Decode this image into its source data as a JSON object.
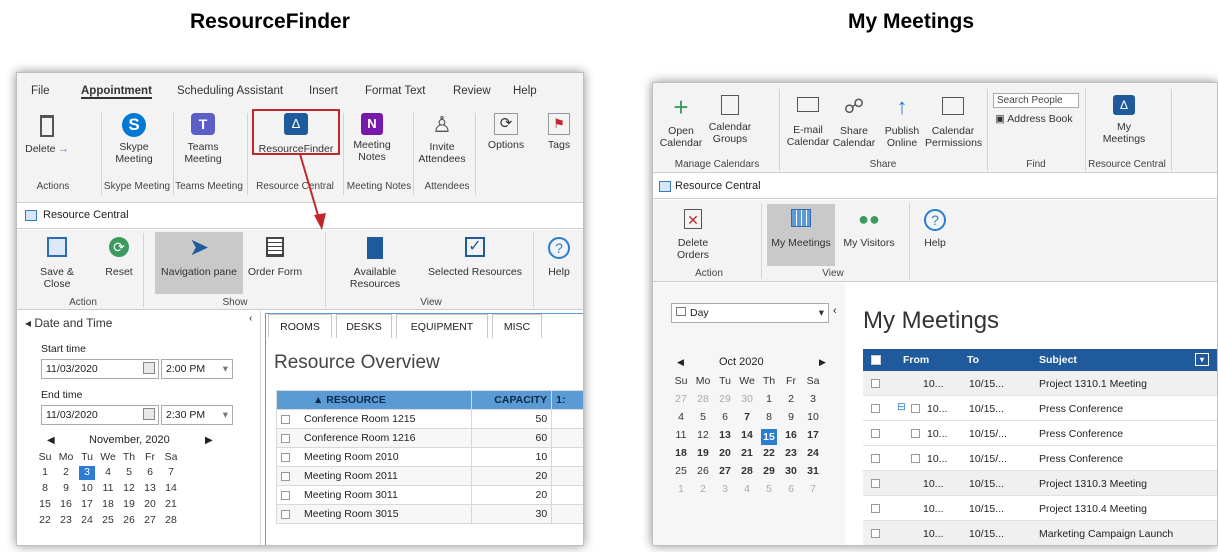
{
  "titles": {
    "left": "ResourceFinder",
    "right": "My Meetings"
  },
  "left": {
    "menu": [
      "File",
      "Appointment",
      "Scheduling Assistant",
      "Insert",
      "Format Text",
      "Review",
      "Help"
    ],
    "ribbon": {
      "delete": "Delete",
      "skype": "Skype Meeting",
      "teams": "Teams Meeting",
      "resourcefinder": "ResourceFinder",
      "notes": "Meeting Notes",
      "invite": "Invite Attendees",
      "options": "Options",
      "tags": "Tags",
      "groups": [
        "Actions",
        "Skype Meeting",
        "Teams Meeting",
        "Resource Central",
        "Meeting Notes",
        "Attendees"
      ]
    },
    "pane_title": "Resource Central",
    "rc_ribbon": {
      "save_close": "Save & Close",
      "reset": "Reset",
      "nav_pane": "Navigation pane",
      "order_form": "Order Form",
      "available": "Available Resources",
      "selected": "Selected Resources",
      "help": "Help",
      "groups": [
        "Action",
        "Show",
        "View"
      ]
    },
    "datetime": {
      "header": "Date and Time",
      "start_label": "Start time",
      "start_date": "11/03/2020",
      "start_time": "2:00 PM",
      "end_label": "End time",
      "end_date": "11/03/2020",
      "end_time": "2:30 PM",
      "month": "November, 2020",
      "weekdays": [
        "Su",
        "Mo",
        "Tu",
        "We",
        "Th",
        "Fr",
        "Sa"
      ],
      "weeks": [
        [
          "1",
          "2",
          "3",
          "4",
          "5",
          "6",
          "7"
        ],
        [
          "8",
          "9",
          "10",
          "11",
          "12",
          "13",
          "14"
        ],
        [
          "15",
          "16",
          "17",
          "18",
          "19",
          "20",
          "21"
        ],
        [
          "22",
          "23",
          "24",
          "25",
          "26",
          "27",
          "28"
        ]
      ],
      "selected": "3"
    },
    "tabs": [
      "ROOMS",
      "DESKS",
      "EQUIPMENT",
      "MISC"
    ],
    "overview_title": "Resource Overview",
    "columns": [
      "▲ RESOURCE",
      "CAPACITY",
      "1:"
    ],
    "rows": [
      [
        "Conference Room 1215",
        "50"
      ],
      [
        "Conference Room 1216",
        "60"
      ],
      [
        "Meeting Room 2010",
        "10"
      ],
      [
        "Meeting Room 2011",
        "20"
      ],
      [
        "Meeting Room 3011",
        "20"
      ],
      [
        "Meeting Room 3015",
        "30"
      ]
    ]
  },
  "right": {
    "ribbon": {
      "open_calendar": "Open Calendar",
      "calendar_groups": "Calendar Groups",
      "email_calendar": "E-mail Calendar",
      "share_calendar": "Share Calendar",
      "publish_online": "Publish Online",
      "calendar_permissions": "Calendar Permissions",
      "search_people": "Search People",
      "address_book": "Address Book",
      "my_meetings": "My Meetings",
      "groups": [
        "Manage Calendars",
        "Share",
        "Find",
        "Resource Central"
      ]
    },
    "pane_title": "Resource Central",
    "rc_ribbon": {
      "delete_orders": "Delete Orders",
      "my_meetings": "My Meetings",
      "my_visitors": "My Visitors",
      "help": "Help",
      "groups": [
        "Action",
        "View"
      ]
    },
    "view_select": "Day",
    "month": "Oct 2020",
    "weekdays": [
      "Su",
      "Mo",
      "Tu",
      "We",
      "Th",
      "Fr",
      "Sa"
    ],
    "weeks": [
      [
        "27",
        "28",
        "29",
        "30",
        "1",
        "2",
        "3"
      ],
      [
        "4",
        "5",
        "6",
        "7",
        "8",
        "9",
        "10"
      ],
      [
        "11",
        "12",
        "13",
        "14",
        "15",
        "16",
        "17"
      ],
      [
        "18",
        "19",
        "20",
        "21",
        "22",
        "23",
        "24"
      ],
      [
        "25",
        "26",
        "27",
        "28",
        "29",
        "30",
        "31"
      ],
      [
        "1",
        "2",
        "3",
        "4",
        "5",
        "6",
        "7"
      ]
    ],
    "bold_days": [
      "7",
      "13",
      "14",
      "16",
      "17",
      "18",
      "19",
      "20",
      "21",
      "22",
      "23",
      "24",
      "27",
      "28",
      "29",
      "30",
      "31"
    ],
    "selected": "15",
    "heading": "My Meetings",
    "columns": [
      "From",
      "To",
      "Subject"
    ],
    "rows": [
      {
        "from": "10...",
        "to": "10/15...",
        "subject": "Project 1310.1 Meeting"
      },
      {
        "from": "10...",
        "to": "10/15...",
        "subject": "Press Conference"
      },
      {
        "from": "10...",
        "to": "10/15/...",
        "subject": "Press Conference"
      },
      {
        "from": "10...",
        "to": "10/15/...",
        "subject": "Press Conference"
      },
      {
        "from": "10...",
        "to": "10/15...",
        "subject": "Project 1310.3 Meeting"
      },
      {
        "from": "10...",
        "to": "10/15...",
        "subject": "Project 1310.4 Meeting"
      },
      {
        "from": "10...",
        "to": "10/15...",
        "subject": "Marketing Campaign Launch"
      }
    ]
  }
}
